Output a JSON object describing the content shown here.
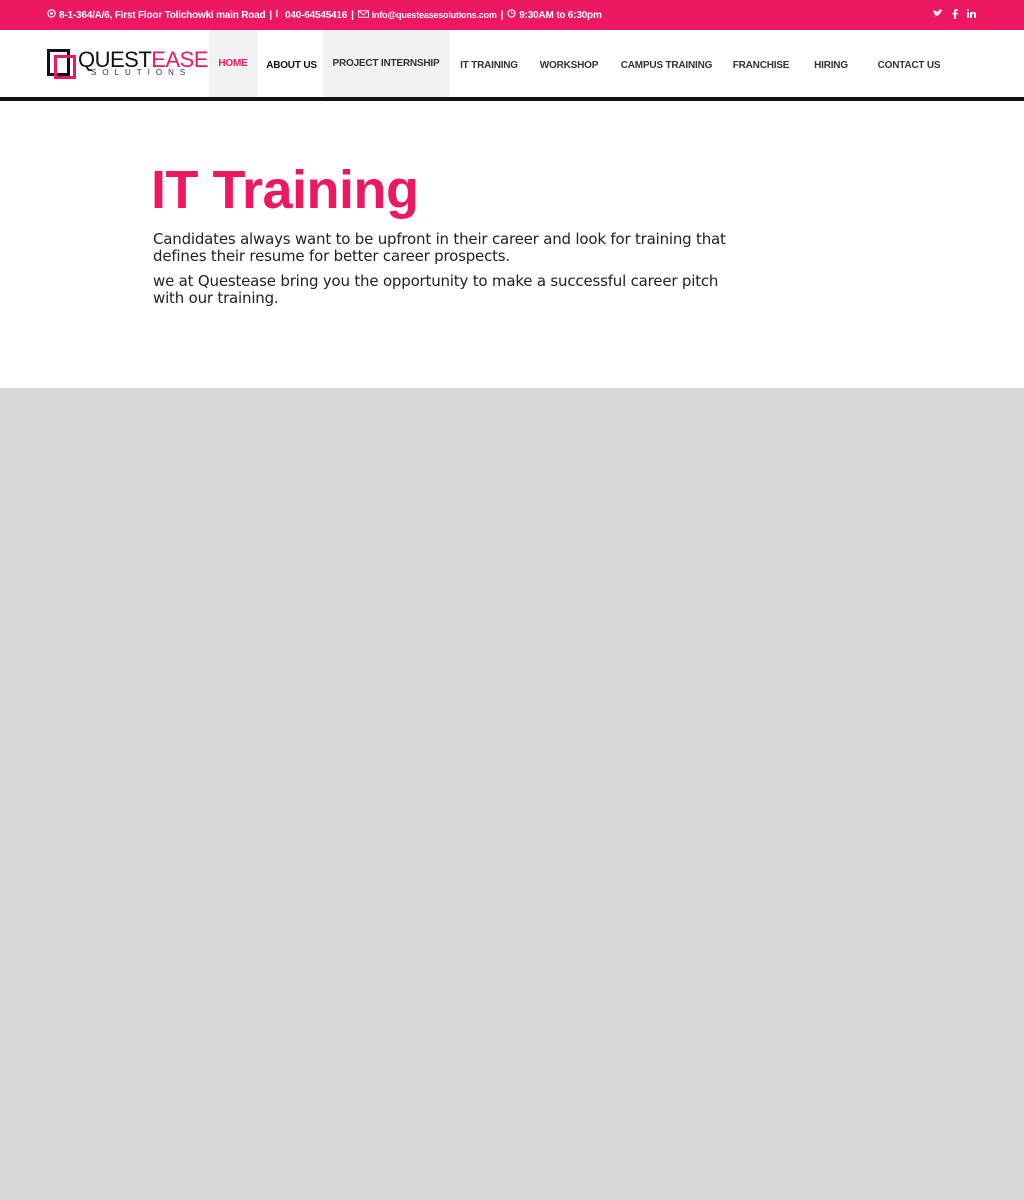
{
  "topbar": {
    "address": "8-1-364/A/6, First Floor Tolichowki main Road",
    "phone": "040-64545416",
    "email": "info@questeasesolutions.com",
    "hours": "9:30AM to 6:30pm",
    "social": [
      "twitter-icon",
      "facebook-icon",
      "linkedin-icon"
    ]
  },
  "logo": {
    "name_part1": "QUEST",
    "name_part2": "EASE",
    "sub": "SOLUTIONS"
  },
  "nav": {
    "items": [
      {
        "label": "HOME"
      },
      {
        "label": "ABOUT US"
      },
      {
        "label": "PROJECT INTERNSHIP"
      },
      {
        "label": "IT TRAINING"
      },
      {
        "label": "WORKSHOP"
      },
      {
        "label": "CAMPUS TRAINING"
      },
      {
        "label": "FRANCHISE"
      },
      {
        "label": "HIRING"
      },
      {
        "label": "CONTACT US"
      }
    ]
  },
  "hero": {
    "title": "IT Training",
    "para1": "Candidates always want to be upfront in their career and look for training that defines their resume for better career prospects.",
    "para2": "we at Questease bring you the opportunity to make a successful career pitch with our training."
  },
  "colors": {
    "brand": "#ee1862",
    "background": "#d5d9da"
  }
}
